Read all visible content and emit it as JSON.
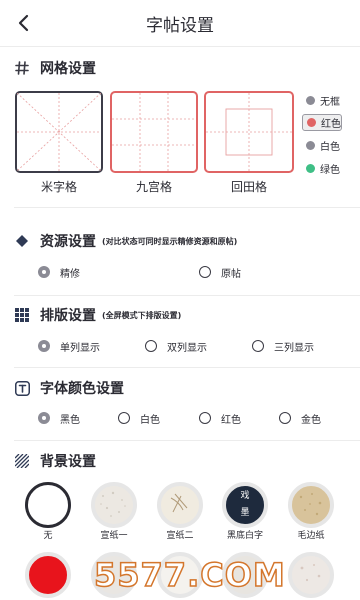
{
  "header": {
    "title": "字帖设置",
    "back_icon": "chevron-left-icon"
  },
  "grid_section": {
    "title": "网格设置",
    "icon": "hash-icon",
    "options": [
      {
        "label": "米字格",
        "selected": true
      },
      {
        "label": "九宫格",
        "selected": false
      },
      {
        "label": "回田格",
        "selected": false
      }
    ],
    "colors": [
      {
        "label": "无框",
        "color": "#8b8b95",
        "selected": false
      },
      {
        "label": "红色",
        "color": "#e06464",
        "selected": true
      },
      {
        "label": "白色",
        "color": "#8b8b95",
        "selected": false
      },
      {
        "label": "绿色",
        "color": "#3fbf86",
        "selected": false
      }
    ]
  },
  "resource_section": {
    "title": "资源设置",
    "hint": "(对比状态可同时显示精修资源和原帖)",
    "icon": "diamond-icon",
    "options": [
      {
        "label": "精修",
        "selected": true
      },
      {
        "label": "原帖",
        "selected": false
      }
    ]
  },
  "layout_section": {
    "title": "排版设置",
    "hint": "(全屏模式下排版设置)",
    "icon": "grid-squares-icon",
    "options": [
      {
        "label": "单列显示",
        "selected": true
      },
      {
        "label": "双列显示",
        "selected": false
      },
      {
        "label": "三列显示",
        "selected": false
      }
    ]
  },
  "font_color_section": {
    "title": "字体颜色设置",
    "icon": "text-t-icon",
    "options": [
      {
        "label": "黑色",
        "selected": true
      },
      {
        "label": "白色",
        "selected": false
      },
      {
        "label": "红色",
        "selected": false
      },
      {
        "label": "金色",
        "selected": false
      }
    ]
  },
  "background_section": {
    "title": "背景设置",
    "icon": "hatch-icon",
    "items": [
      {
        "label": "无",
        "fill": "#ffffff",
        "selected": true
      },
      {
        "label": "宣纸一",
        "fill": "#ece8e2",
        "selected": false
      },
      {
        "label": "宣纸二",
        "fill": "#f0ebe0",
        "selected": false
      },
      {
        "label": "黑底白字",
        "fill": "#1e2a3d",
        "selected": false,
        "text_top": "戏",
        "text_bottom": "墨"
      },
      {
        "label": "毛边纸",
        "fill": "#d8c39b",
        "selected": false
      }
    ],
    "row2": [
      {
        "fill": "#e8141c"
      },
      {
        "fill": "#e9e6e2"
      },
      {
        "fill": "#f4f2ee"
      },
      {
        "fill": "#e8e5e0"
      },
      {
        "fill": "#ede8e4"
      }
    ]
  },
  "watermark": {
    "text": "5577.COM"
  }
}
